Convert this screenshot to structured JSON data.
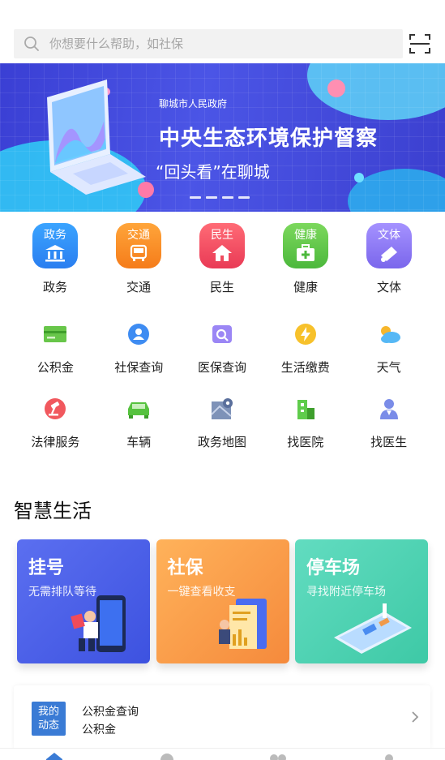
{
  "search": {
    "placeholder": "你想要什么帮助，如社保"
  },
  "banner": {
    "gov": "聊城市人民政府",
    "headline": "中央生态环境保护督察",
    "sub": "“回头看”在聊城"
  },
  "categories": [
    {
      "tile": "政务",
      "label": "政务",
      "color": "#2a8cf0"
    },
    {
      "tile": "交通",
      "label": "交通",
      "color": "#f58a1f"
    },
    {
      "tile": "民生",
      "label": "民生",
      "color": "#ef4b5e"
    },
    {
      "tile": "健康",
      "label": "健康",
      "color": "#5cc64a"
    },
    {
      "tile": "文体",
      "label": "文体",
      "color": "#8a7af2"
    }
  ],
  "services": [
    {
      "label": "公积金",
      "icon": "card-icon"
    },
    {
      "label": "社保查询",
      "icon": "social-security-icon"
    },
    {
      "label": "医保查询",
      "icon": "medical-insurance-icon"
    },
    {
      "label": "生活缴费",
      "icon": "bolt-icon"
    },
    {
      "label": "天气",
      "icon": "weather-icon"
    },
    {
      "label": "法律服务",
      "icon": "gavel-icon"
    },
    {
      "label": "车辆",
      "icon": "car-icon"
    },
    {
      "label": "政务地图",
      "icon": "map-icon"
    },
    {
      "label": "找医院",
      "icon": "hospital-icon"
    },
    {
      "label": "找医生",
      "icon": "doctor-icon"
    }
  ],
  "smart_life": {
    "title": "智慧生活",
    "cards": [
      {
        "title": "挂号",
        "sub": "无需排队等待"
      },
      {
        "title": "社保",
        "sub": "一键查看收支"
      },
      {
        "title": "停车场",
        "sub": "寻找附近停车场"
      }
    ]
  },
  "dynamic": {
    "badge_line1": "我的",
    "badge_line2": "动态",
    "line1": "公积金查询",
    "line2": "公积金"
  },
  "colors": {
    "accent": "#3a7bd5",
    "banner": "#4b55e6",
    "card_register": "#4a5fe6",
    "card_social": "#f7a24a",
    "card_parking": "#4fd4b0"
  }
}
